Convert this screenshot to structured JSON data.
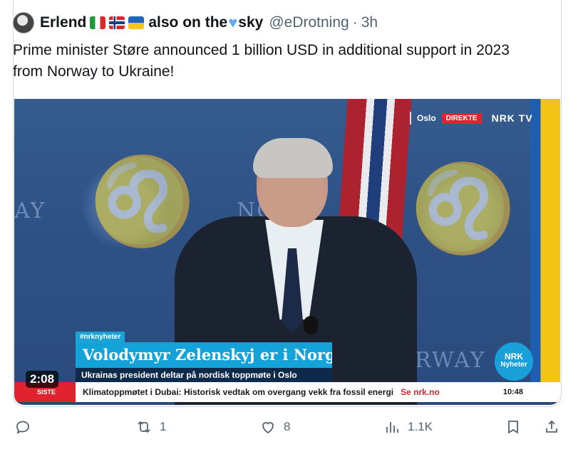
{
  "author": {
    "name": "Erlend",
    "name_suffix": "also on the",
    "name_end": "sky",
    "flags": [
      "italy-flag-icon",
      "norway-flag-icon",
      "ukraine-flag-icon"
    ],
    "handle": "@eDrotning",
    "separator": "·",
    "time": "3h"
  },
  "tweet": {
    "text": "Prime minister Støre announced 1 billion USD in additional support in 2023 from Norway to Ukraine!"
  },
  "video": {
    "location": "Oslo",
    "live_label": "DIREKTE",
    "channel": "NRK TV",
    "hashtag": "#nrknyheter",
    "headline": "Volodymyr Zelenskyj er i Norge",
    "subheadline": "Ukrainas president deltar på nordisk toppmøte i Oslo",
    "badge_line1": "NRK",
    "badge_line2": "Nyheter",
    "ticker_label": "SISTE",
    "ticker_text": "Klimatoppmøtet i Dubai: Historisk vedtak om overgang vekk fra fossil energi",
    "ticker_link": "Se nrk.no",
    "ticker_time": "10:48",
    "duration": "2:08",
    "watermark_left": "AY",
    "watermark_mid": "NO",
    "watermark_right": "RWAY"
  },
  "actions": {
    "reply_count": "",
    "retweet_count": "1",
    "like_count": "8",
    "views_count": "1.1K"
  },
  "colors": {
    "accent_blue": "#14a3d8",
    "live_red": "#e0232f",
    "text_secondary": "#536471"
  }
}
